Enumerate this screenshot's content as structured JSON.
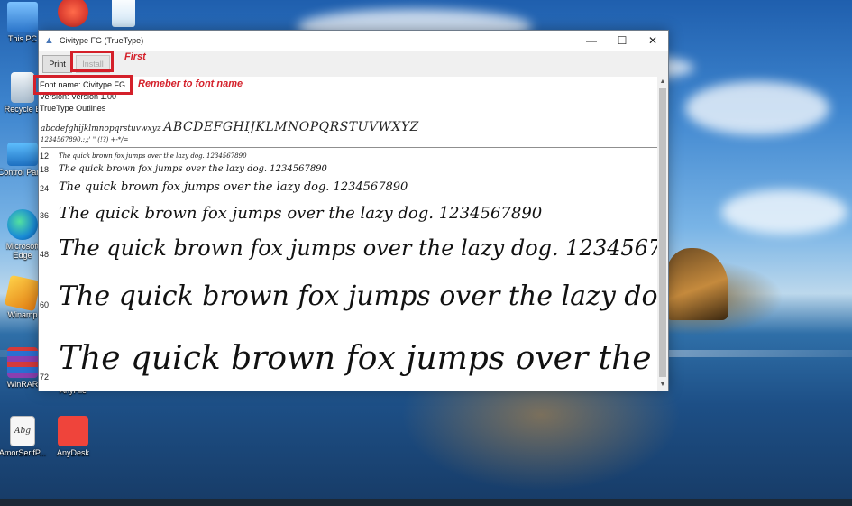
{
  "desktop": {
    "icons": [
      {
        "label": "This PC",
        "icon": "computer-icon",
        "color": "#3a8ee6"
      },
      {
        "label": "Recycle B",
        "icon": "recycle-bin-icon",
        "color": "#c9d7e4"
      },
      {
        "label": "Control Panel",
        "icon": "control-panel-icon",
        "color": "#2f9be0"
      },
      {
        "label": "Microsoft Edge",
        "icon": "edge-icon",
        "color": "#1fa2d8"
      },
      {
        "label": "Winamp",
        "icon": "winamp-icon",
        "color": "#f2a21b"
      },
      {
        "label": "WinRAR",
        "icon": "winrar-icon",
        "color": "#7b3ea0"
      },
      {
        "label": "AmorSerifP...",
        "icon": "font-file-icon",
        "color": "#f4f4f4"
      },
      {
        "label": "AnyDesk",
        "icon": "anydesk-icon",
        "color": "#ef443b"
      },
      {
        "label": "AnyFile",
        "icon": "anyfile-icon",
        "color": "#ffffff"
      }
    ],
    "top_icons": [
      {
        "icon": "ccleaner-icon",
        "color": "#d62b2b"
      },
      {
        "icon": "edge-icon",
        "color": "#1fa2d8"
      }
    ]
  },
  "window": {
    "title": "Civitype FG (TrueType)",
    "controls": {
      "minimize": "—",
      "maximize": "☐",
      "close": "✕"
    },
    "toolbar": {
      "print_label": "Print",
      "install_label": "Install"
    },
    "info": {
      "font_name": "Font name: Civitype FG",
      "version": "Version: Version 1.00",
      "outlines": "TrueType Outlines"
    },
    "charset": {
      "lowercase": "abcdefghijklmnopqrstuvwxyz",
      "uppercase": "ABCDEFGHIJKLMNOPQRSTUVWXYZ",
      "digits": "1234567890.:,;' \" (!?) +-*/=",
      "sample_text": "The quick brown fox jumps over the lazy dog. 1234567890",
      "sizes": [
        "12",
        "18",
        "24",
        "36",
        "48",
        "60",
        "72"
      ]
    },
    "scrollbar": {
      "up": "▲",
      "down": "▼"
    }
  },
  "annotations": {
    "first": "First",
    "font_name_note": "Remeber to font name"
  }
}
